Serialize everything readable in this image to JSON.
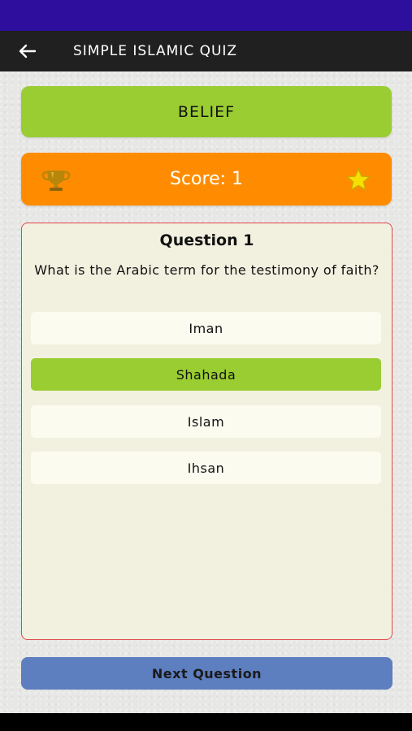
{
  "app_bar": {
    "title": "SIMPLE ISLAMIC QUIZ",
    "back_icon": "arrow-left-icon"
  },
  "category": {
    "label": "BELIEF",
    "color": "#9acd32"
  },
  "score": {
    "label": "Score: 1",
    "left_icon": "trophy-icon",
    "right_icon": "star-icon",
    "color": "#ff8c00"
  },
  "question": {
    "number_label": "Question 1",
    "text": "What is the Arabic term for the testimony of faith?",
    "border_color": "#e0484a",
    "options": [
      {
        "label": "Iman",
        "selected": false
      },
      {
        "label": "Shahada",
        "selected": true
      },
      {
        "label": "Islam",
        "selected": false
      },
      {
        "label": "Ihsan",
        "selected": false
      }
    ]
  },
  "next_button": {
    "label": "Next Question",
    "color": "#5d7ebf"
  },
  "colors": {
    "status_bar": "#2e0e9c",
    "app_bar": "#202020",
    "selected_option": "#9acd32"
  }
}
